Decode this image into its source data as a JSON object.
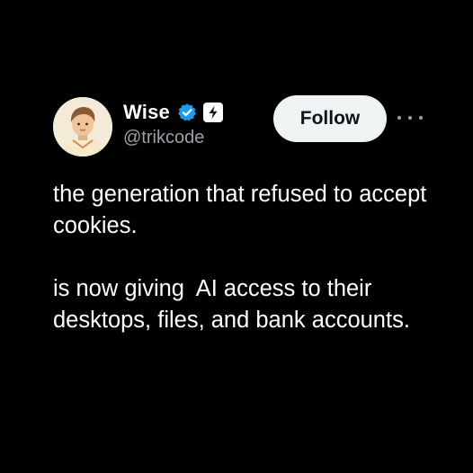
{
  "tweet": {
    "author": {
      "display_name": "Wise",
      "handle": "@trikcode",
      "verified": true,
      "avatar_icon": "avatar-illustration",
      "badges": [
        "verified-badge-icon",
        "lightning-badge-icon"
      ]
    },
    "actions": {
      "follow_label": "Follow",
      "more_icon": "more-options-icon"
    },
    "text": {
      "paragraph_1": "the generation that refused to accept cookies.",
      "paragraph_2": "is now giving  AI access to their desktops, files, and bank accounts."
    }
  },
  "colors": {
    "background": "#000000",
    "text": "#ffffff",
    "secondary_text": "#9aa0a6",
    "verified_blue": "#1d9bf0",
    "follow_bg": "#eff3f4",
    "follow_text": "#0f1419"
  }
}
